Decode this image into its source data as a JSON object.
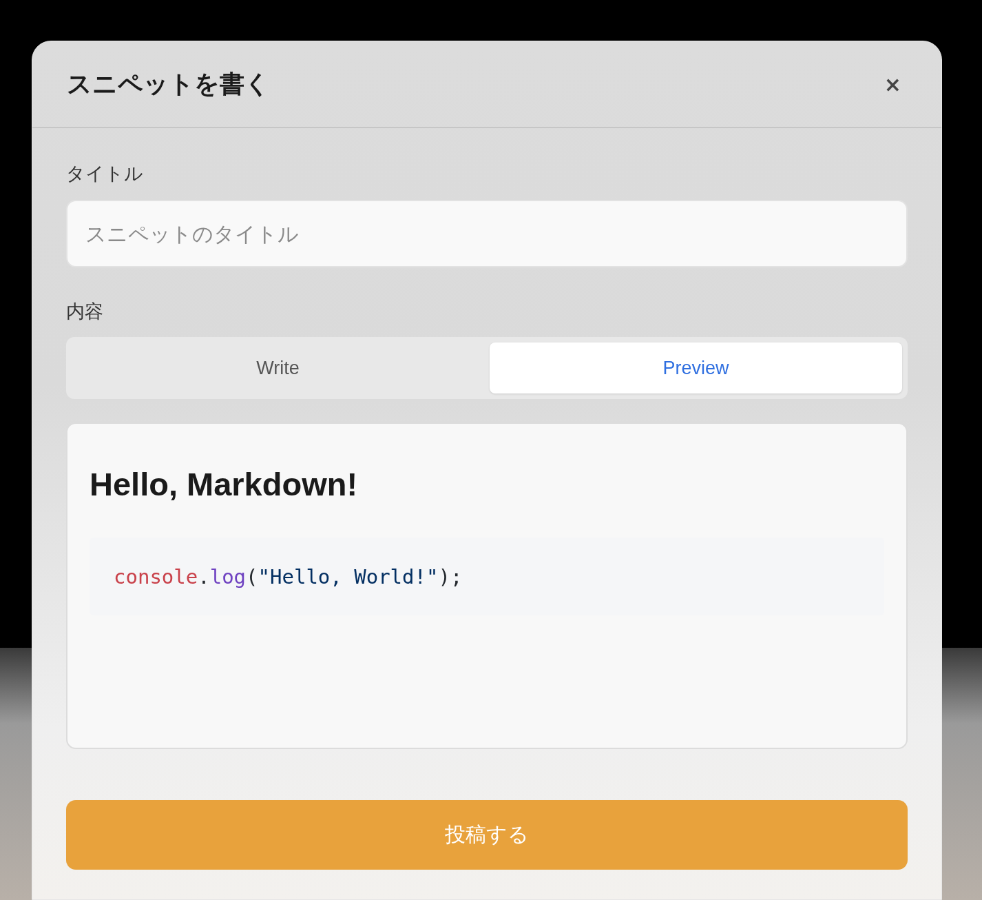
{
  "dialog": {
    "title": "スニペットを書く",
    "close": "×"
  },
  "title_field": {
    "label": "タイトル",
    "placeholder": "スニペットのタイトル"
  },
  "content_field": {
    "label": "内容"
  },
  "tabs": [
    {
      "label": "Write",
      "selected": false
    },
    {
      "label": "Preview",
      "selected": true
    }
  ],
  "preview": {
    "heading": "Hello, Markdown!",
    "code": [
      {
        "kind": "object",
        "text": "console"
      },
      {
        "kind": "punct",
        "text": "."
      },
      {
        "kind": "function",
        "text": "log"
      },
      {
        "kind": "punct",
        "text": "("
      },
      {
        "kind": "string",
        "text": "\"Hello, World!\""
      },
      {
        "kind": "punct",
        "text": ");"
      }
    ]
  },
  "submit": {
    "label": "投稿する"
  }
}
